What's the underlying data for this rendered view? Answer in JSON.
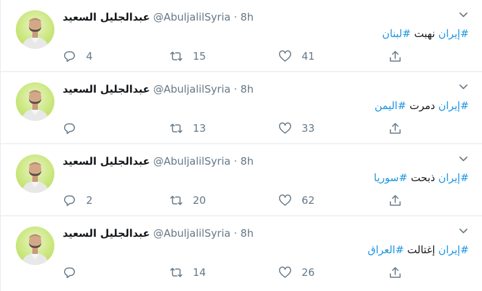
{
  "tweets": [
    {
      "name": "عبدالجليل السعيد",
      "handle": "@AbuljalilSyria",
      "dot": "·",
      "time": "8h",
      "hashtag1": "#إيران",
      "text": "نهبت",
      "hashtag2": "#لبنان",
      "reply_count": "4",
      "retweet_count": "15",
      "like_count": "41"
    },
    {
      "name": "عبدالجليل السعيد",
      "handle": "@AbuljalilSyria",
      "dot": "·",
      "time": "8h",
      "hashtag1": "#إيران",
      "text": "دمرت",
      "hashtag2": "#اليمن",
      "reply_count": "",
      "retweet_count": "13",
      "like_count": "33"
    },
    {
      "name": "عبدالجليل السعيد",
      "handle": "@AbuljalilSyria",
      "dot": "·",
      "time": "8h",
      "hashtag1": "#إيران",
      "text": "ذبحت",
      "hashtag2": "#سوريا",
      "reply_count": "2",
      "retweet_count": "20",
      "like_count": "62"
    },
    {
      "name": "عبدالجليل السعيد",
      "handle": "@AbuljalilSyria",
      "dot": "·",
      "time": "8h",
      "hashtag1": "#إيران",
      "text": "إغتالت",
      "hashtag2": "#العراق",
      "reply_count": "",
      "retweet_count": "14",
      "like_count": "26"
    }
  ],
  "icons": {
    "reply": "reply-icon",
    "retweet": "retweet-icon",
    "like": "heart-icon",
    "share": "share-icon",
    "caret": "chevron-down-icon",
    "avatar": "profile-photo"
  },
  "colors": {
    "hashtag": "#1b95e0",
    "muted": "#657786",
    "avatar_bg": "#c9e67a"
  }
}
